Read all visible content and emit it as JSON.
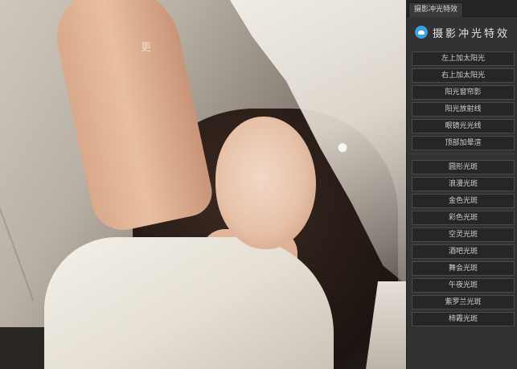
{
  "panel": {
    "tab_label": "摄影冲光特效",
    "brand_title": "摄影冲光特效",
    "brand_icon": "cloud-icon",
    "group1": [
      "左上加太阳光",
      "右上加太阳光",
      "阳光窗帘影",
      "阳光放射线",
      "眼镜光光线",
      "顶部加晕渲"
    ],
    "group2": [
      "圆形光斑",
      "浪漫光斑",
      "金色光斑",
      "彩色光斑",
      "空灵光斑",
      "酒吧光斑",
      "舞会光斑",
      "午夜光斑",
      "紫罗兰光斑",
      "柿霞光斑"
    ]
  },
  "photo": {
    "watermark": "更"
  }
}
